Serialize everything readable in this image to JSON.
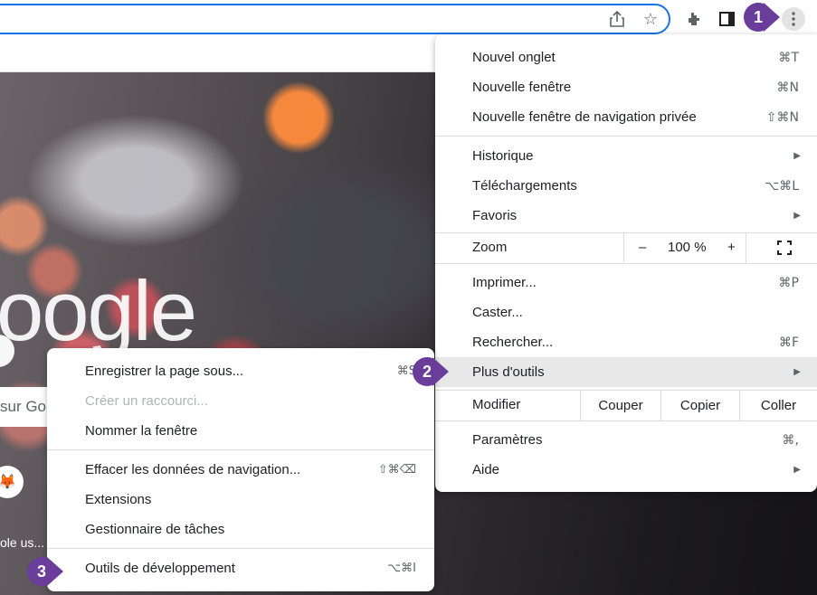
{
  "toolbar": {
    "icons": [
      "share-icon",
      "bookmark-star-icon",
      "extensions-puzzle-icon",
      "side-panel-icon",
      "more-vertical-icon"
    ]
  },
  "background": {
    "logo_text": "oogle",
    "search_text": "sur Go",
    "tile_label": "ole us..."
  },
  "menu": {
    "items": [
      {
        "label": "Nouvel onglet",
        "shortcut": "⌘T"
      },
      {
        "label": "Nouvelle fenêtre",
        "shortcut": "⌘N"
      },
      {
        "label": "Nouvelle fenêtre de navigation privée",
        "shortcut": "⇧⌘N"
      },
      {
        "label": "Historique",
        "shortcut": "▶"
      },
      {
        "label": "Téléchargements",
        "shortcut": "⌥⌘L"
      },
      {
        "label": "Favoris",
        "shortcut": "▶"
      }
    ],
    "zoom": {
      "label": "Zoom",
      "minus": "–",
      "value": "100 %",
      "plus": "+"
    },
    "items2": [
      {
        "label": "Imprimer...",
        "shortcut": "⌘P"
      },
      {
        "label": "Caster...",
        "shortcut": ""
      },
      {
        "label": "Rechercher...",
        "shortcut": "⌘F"
      },
      {
        "label": "Plus d'outils",
        "shortcut": "▶"
      }
    ],
    "edit": {
      "label": "Modifier",
      "cut": "Couper",
      "copy": "Copier",
      "paste": "Coller"
    },
    "items3": [
      {
        "label": "Paramètres",
        "shortcut": "⌘,"
      },
      {
        "label": "Aide",
        "shortcut": "▶"
      }
    ]
  },
  "submenu": {
    "items": [
      {
        "label": "Enregistrer la page sous...",
        "shortcut": "⌘S"
      },
      {
        "label": "Créer un raccourci...",
        "shortcut": ""
      },
      {
        "label": "Nommer la fenêtre",
        "shortcut": ""
      },
      {
        "label": "Effacer les données de navigation...",
        "shortcut": "⇧⌘⌫"
      },
      {
        "label": "Extensions",
        "shortcut": ""
      },
      {
        "label": "Gestionnaire de tâches",
        "shortcut": ""
      },
      {
        "label": "Outils de développement",
        "shortcut": "⌥⌘I"
      }
    ]
  },
  "badges": {
    "one": "1",
    "two": "2",
    "three": "3"
  },
  "colors": {
    "accent": "#1a73e8",
    "badge": "#6a3d9a",
    "highlight": "#e8e8e8"
  }
}
